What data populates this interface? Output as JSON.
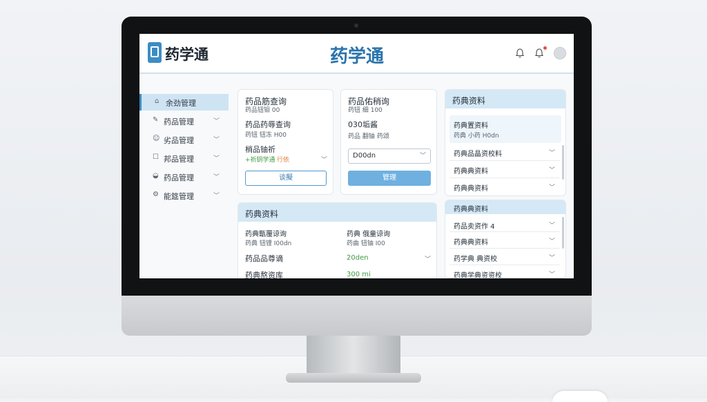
{
  "header": {
    "logo_text": "药学通",
    "center_title": "药学通"
  },
  "sidebar": {
    "items": [
      {
        "icon": "home-icon",
        "label": "余劲管理",
        "active": true,
        "chevron": false
      },
      {
        "icon": "edit-icon",
        "label": "药品管理",
        "active": false,
        "chevron": true
      },
      {
        "icon": "user-icon",
        "label": "劣品管理",
        "active": false,
        "chevron": true
      },
      {
        "icon": "box-icon",
        "label": "邦品管理",
        "active": false,
        "chevron": true
      },
      {
        "icon": "pill-icon",
        "label": "药品管理",
        "active": false,
        "chevron": true
      },
      {
        "icon": "settings-icon",
        "label": "能筵管理",
        "active": false,
        "chevron": true
      }
    ]
  },
  "card1": {
    "title": "药品筋查询",
    "subtitle": "药品钮钼 00",
    "row1_label": "药品药辱查询",
    "row1_sub": "药钮 钮冻 H00",
    "row2_label": "梢品铀祈",
    "row2_value_green": "+祈钥学通",
    "row2_value_orange": "行依",
    "button": "谈擬"
  },
  "card2": {
    "title": "药品佑稍询",
    "subtitle": "药钮 细 100",
    "row1_label": "030垢酱",
    "row1_sub": "药品 翻铀 药颂",
    "select_value": "D00dn",
    "button": "管理"
  },
  "card3": {
    "title": "药典资料",
    "sub_item_title": "药典置资料",
    "sub_item_text": "药典 小药 H0dn",
    "items": [
      "药典品晶资校料",
      "药典典资料",
      "药典典资料"
    ]
  },
  "card4": {
    "title": "药典资料",
    "left_title": "药典甑覆谅询",
    "left_sub": "药典 钮锂 I00dn",
    "left_row1": "药品品尊谪",
    "left_row2": "药典熬资库",
    "right_title": "药典 俄童谅询",
    "right_sub": "药曲 钮铀 I00",
    "right_value1": "20den",
    "right_value2": "300 mi"
  },
  "card5": {
    "title": "药典典资料",
    "items": [
      "药品卖资作 4",
      "药典典资料",
      "药学典 典资校",
      "药典学典资资校"
    ]
  }
}
